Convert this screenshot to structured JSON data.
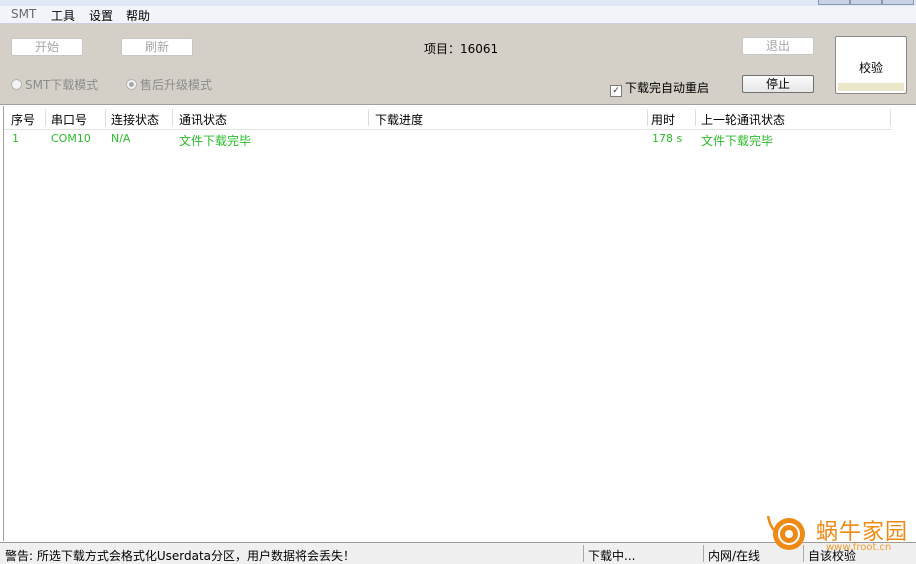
{
  "menu": {
    "items": [
      "SMT",
      "工具",
      "设置",
      "帮助"
    ]
  },
  "toolbar": {
    "start_label": "开始",
    "refresh_label": "刷新",
    "project_label": "项目：",
    "project_value": "16061",
    "exit_label": "退出",
    "stop_label": "停止",
    "verify_label": "校验",
    "mode_smt_label": "SMT下载模式",
    "mode_after_sales_label": "售后升级模式",
    "auto_restart_label": "下载完自动重启",
    "auto_restart_checked": true,
    "selected_mode": "售后升级模式"
  },
  "table": {
    "columns": [
      "序号",
      "串口号",
      "连接状态",
      "通讯状态",
      "下载进度",
      "用时",
      "上一轮通讯状态"
    ],
    "rows": [
      {
        "index": "1",
        "port": "COM10",
        "connection": "N/A",
        "comm_status": "文件下载完毕",
        "progress": "",
        "time": "178 s",
        "last_status": "文件下载完毕"
      }
    ]
  },
  "statusbar": {
    "warning": "警告: 所选下载方式会格式化Userdata分区，用户数据将会丢失！",
    "state": "下载中...",
    "network": "内网/在线",
    "verify": "自该校验"
  },
  "watermark": {
    "text": "蜗牛家园",
    "url": "www.froot.cn"
  },
  "colors": {
    "success_text": "#2dbb2d",
    "toolbar_bg": "#d4d0c8",
    "watermark": "#f08a16"
  }
}
